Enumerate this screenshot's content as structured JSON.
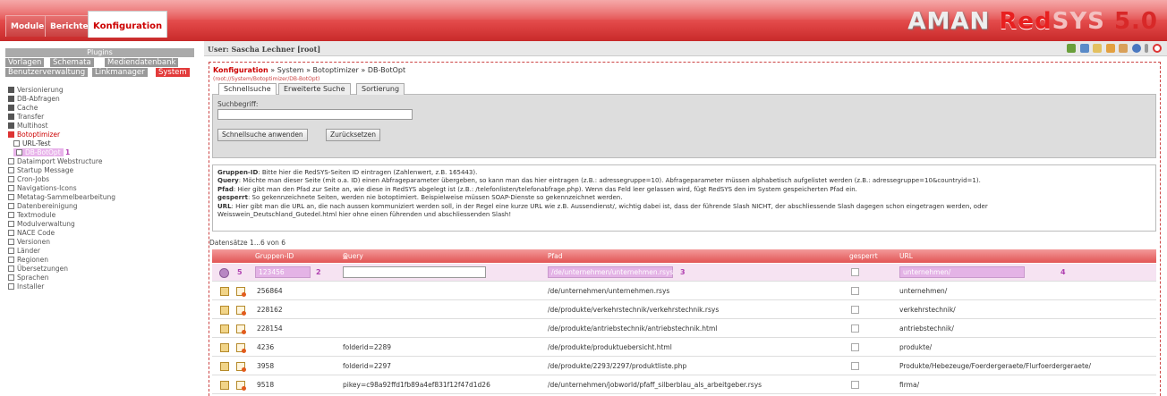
{
  "header": {
    "tabs": [
      {
        "label": "Module"
      },
      {
        "label": "Berichte"
      },
      {
        "label": "Konfiguration",
        "active": true
      }
    ],
    "logo": {
      "part1": "AMAN",
      "part2": "Red",
      "part3": "SYS",
      "part4": "5.0"
    }
  },
  "sidebar": {
    "plugins_label": "Plugins",
    "tabs_row1": [
      "Vorlagen",
      "Schemata",
      "Mediendatenbank"
    ],
    "tabs_row2": [
      "Benutzerverwaltung",
      "Linkmanager",
      "System"
    ],
    "items": [
      {
        "label": "Versionierung",
        "icon": "expand-icon"
      },
      {
        "label": "DB-Abfragen",
        "icon": "expand-icon"
      },
      {
        "label": "Cache",
        "icon": "expand-icon"
      },
      {
        "label": "Transfer",
        "icon": "expand-icon"
      },
      {
        "label": "Multihost",
        "icon": "expand-icon"
      },
      {
        "label": "Botoptimizer",
        "icon": "collapse-icon"
      },
      {
        "label": "URL-Test",
        "icon": "page-icon"
      },
      {
        "label": "DB-BotOpt",
        "icon": "page-icon",
        "badge": "1"
      },
      {
        "label": "Dataimport Webstructure",
        "icon": "page-icon"
      },
      {
        "label": "Startup Message",
        "icon": "page-icon"
      },
      {
        "label": "Cron-Jobs",
        "icon": "page-icon"
      },
      {
        "label": "Navigations-Icons",
        "icon": "page-icon"
      },
      {
        "label": "Metatag-Sammelbearbeitung",
        "icon": "page-icon"
      },
      {
        "label": "Datenbereinigung",
        "icon": "page-icon"
      },
      {
        "label": "Textmodule",
        "icon": "page-icon"
      },
      {
        "label": "Modulverwaltung",
        "icon": "page-icon"
      },
      {
        "label": "NACE Code",
        "icon": "page-icon"
      },
      {
        "label": "Versionen",
        "icon": "page-icon"
      },
      {
        "label": "Länder",
        "icon": "page-icon"
      },
      {
        "label": "Regionen",
        "icon": "page-icon"
      },
      {
        "label": "Übersetzungen",
        "icon": "page-icon"
      },
      {
        "label": "Sprachen",
        "icon": "page-icon"
      },
      {
        "label": "Installer",
        "icon": "page-icon"
      }
    ]
  },
  "userbar": {
    "text": "User: Sascha Lechner [root]"
  },
  "breadcrumb": {
    "root": "Konfiguration",
    "sep": "»",
    "c1": "System",
    "c2": "Botoptimizer",
    "c3": "DB-BotOpt",
    "path": "(root://System/Botoptimizer/DB-BotOpt)"
  },
  "search": {
    "tabs": [
      "Schnellsuche",
      "Erweiterte Suche",
      "Sortierung"
    ],
    "label": "Suchbegriff:",
    "apply": "Schnellsuche anwenden",
    "reset": "Zurücksetzen"
  },
  "info": {
    "l1b": "Gruppen-ID",
    "l1": ": Bitte hier die RedSYS-Seiten ID eintragen (Zahlenwert, z.B. 165443).",
    "l2b": "Query",
    "l2": ": Möchte man dieser Seite (mit o.a. ID) einen Abfrageparameter übergeben, so kann man das hier eintragen (z.B.: adressegruppe=10). Abfrageparameter müssen alphabetisch aufgelistet werden (z.B.: adressegruppe=10&countryid=1).",
    "l3b": "Pfad",
    "l3": ": Hier gibt man den Pfad zur Seite an, wie diese in RedSYS abgelegt ist (z.B.: /telefonlisten/telefonabfrage.php). Wenn das Feld leer gelassen wird, fügt RedSYS den im System gespeicherten Pfad ein.",
    "l4b": "gesperrt",
    "l4": ": So gekennzeichnete Seiten, werden nie botoptimiert. Beispielweise müssen SOAP-Dienste so gekennzeichnet werden.",
    "l5b": "URL",
    "l5": ": Hier gibt man die URL an, die nach aussen kommuniziert werden soll, in der Regel eine kurze URL wie z.B. Aussendienst/, wichtig dabei ist, dass der führende Slash NICHT, der abschliessende Slash dagegen schon eingetragen werden, oder",
    "l6": "Weisswein_Deutschland_Gutedel.html hier ohne einen führenden und abschliessenden Slash!"
  },
  "count": "Datensätze 1...6 von 6",
  "table": {
    "headers": {
      "gid": "Gruppen-ID",
      "query": "Query",
      "sort": "▲",
      "pfad": "Pfad",
      "gesperrt": "gesperrt",
      "url": "URL"
    },
    "edit_row": {
      "gid": "123456",
      "query": "",
      "pfad": "/de/unternehmen/unternehmen.rsys",
      "url": "unternehmen/",
      "n2": "2",
      "n3": "3",
      "n4": "4",
      "n5": "5"
    },
    "rows": [
      {
        "gid": "256864",
        "query": "",
        "pfad": "/de/unternehmen/unternehmen.rsys",
        "url": "unternehmen/"
      },
      {
        "gid": "228162",
        "query": "",
        "pfad": "/de/produkte/verkehrstechnik/verkehrstechnik.rsys",
        "url": "verkehrstechnik/"
      },
      {
        "gid": "228154",
        "query": "",
        "pfad": "/de/produkte/antriebstechnik/antriebstechnik.html",
        "url": "antriebstechnik/"
      },
      {
        "gid": "4236",
        "query": "folderid=2289",
        "pfad": "/de/produkte/produktuebersicht.html",
        "url": "produkte/"
      },
      {
        "gid": "3958",
        "query": "folderid=2297",
        "pfad": "/de/produkte/2293/2297/produktliste.php",
        "url": "Produkte/Hebezeuge/Foerdergeraete/Flurfoerdergeraete/"
      },
      {
        "gid": "9518",
        "query": "pikey=c98a92ffd1fb89a4ef831f12f47d1d26",
        "pfad": "/de/unternehmen/jobworld/pfaff_silberblau_als_arbeitgeber.rsys",
        "url": "firma/"
      }
    ]
  },
  "colors": {
    "accent": "#e23a3a",
    "highlight": "#e4b3e6",
    "badge": "#b040b0"
  }
}
